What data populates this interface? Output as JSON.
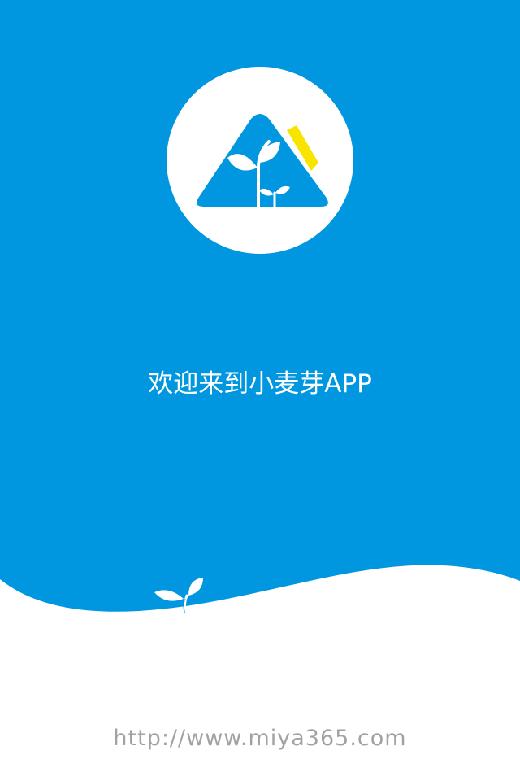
{
  "splash": {
    "welcome_text": "欢迎来到小麦芽APP",
    "website_url": "http://www.miya365.com",
    "logo_icon": "mountain-sprout-logo-icon",
    "sprout_icon": "sprout-icon"
  },
  "colors": {
    "background_blue": "#0197e0",
    "wave_white": "#ffffff",
    "accent_yellow": "#f7e500",
    "url_gray": "#a2a2a2"
  }
}
